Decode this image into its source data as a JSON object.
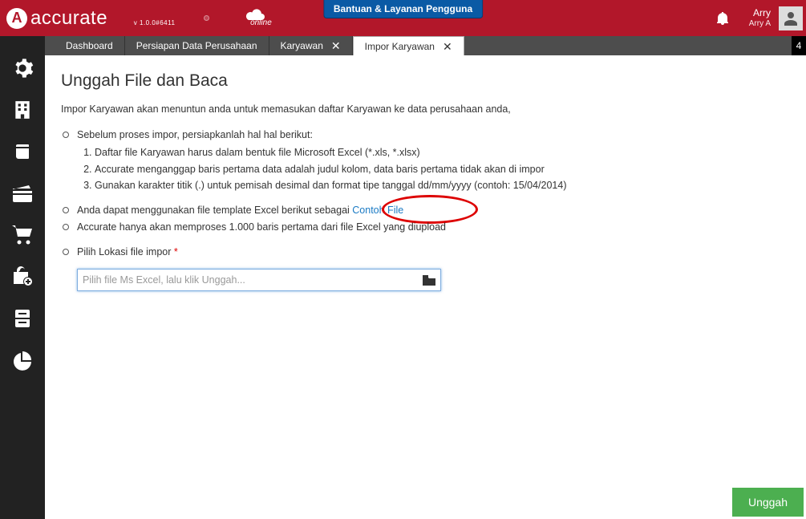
{
  "brand": {
    "name": "accurate",
    "version": "v 1.0.0#6411",
    "edition": "online"
  },
  "topbar": {
    "help_label": "Bantuan & Layanan Pengguna"
  },
  "user": {
    "name": "Arry",
    "sub": "Arry A"
  },
  "tabs": {
    "items": [
      {
        "label": "Dashboard",
        "closable": false
      },
      {
        "label": "Persiapan Data Perusahaan",
        "closable": false
      },
      {
        "label": "Karyawan",
        "closable": true
      },
      {
        "label": "Impor Karyawan",
        "closable": true,
        "active": true
      }
    ],
    "counter": "4"
  },
  "page": {
    "title": "Unggah File dan Baca",
    "subtitle": "Impor Karyawan akan menuntun anda untuk memasukan daftar Karyawan ke data perusahaan anda,",
    "prep_intro": "Sebelum proses impor, persiapkanlah hal hal berikut:",
    "prep_items": [
      "Daftar file Karyawan harus dalam bentuk file Microsoft Excel (*.xls, *.xlsx)",
      "Accurate menganggap baris pertama data adalah judul kolom, data baris pertama tidak akan di impor",
      "Gunakan karakter titik (.) untuk pemisah desimal dan format tipe tanggal dd/mm/yyyy (contoh: 15/04/2014)"
    ],
    "template_pre": "Anda dapat menggunakan file template Excel berikut sebagai ",
    "template_link": "Contoh File",
    "limit_note": "Accurate hanya akan memproses 1.000 baris pertama dari file Excel yang diupload",
    "file_label": "Pilih Lokasi file impor ",
    "file_placeholder": "Pilih file Ms Excel, lalu klik Unggah...",
    "upload_btn": "Unggah"
  }
}
